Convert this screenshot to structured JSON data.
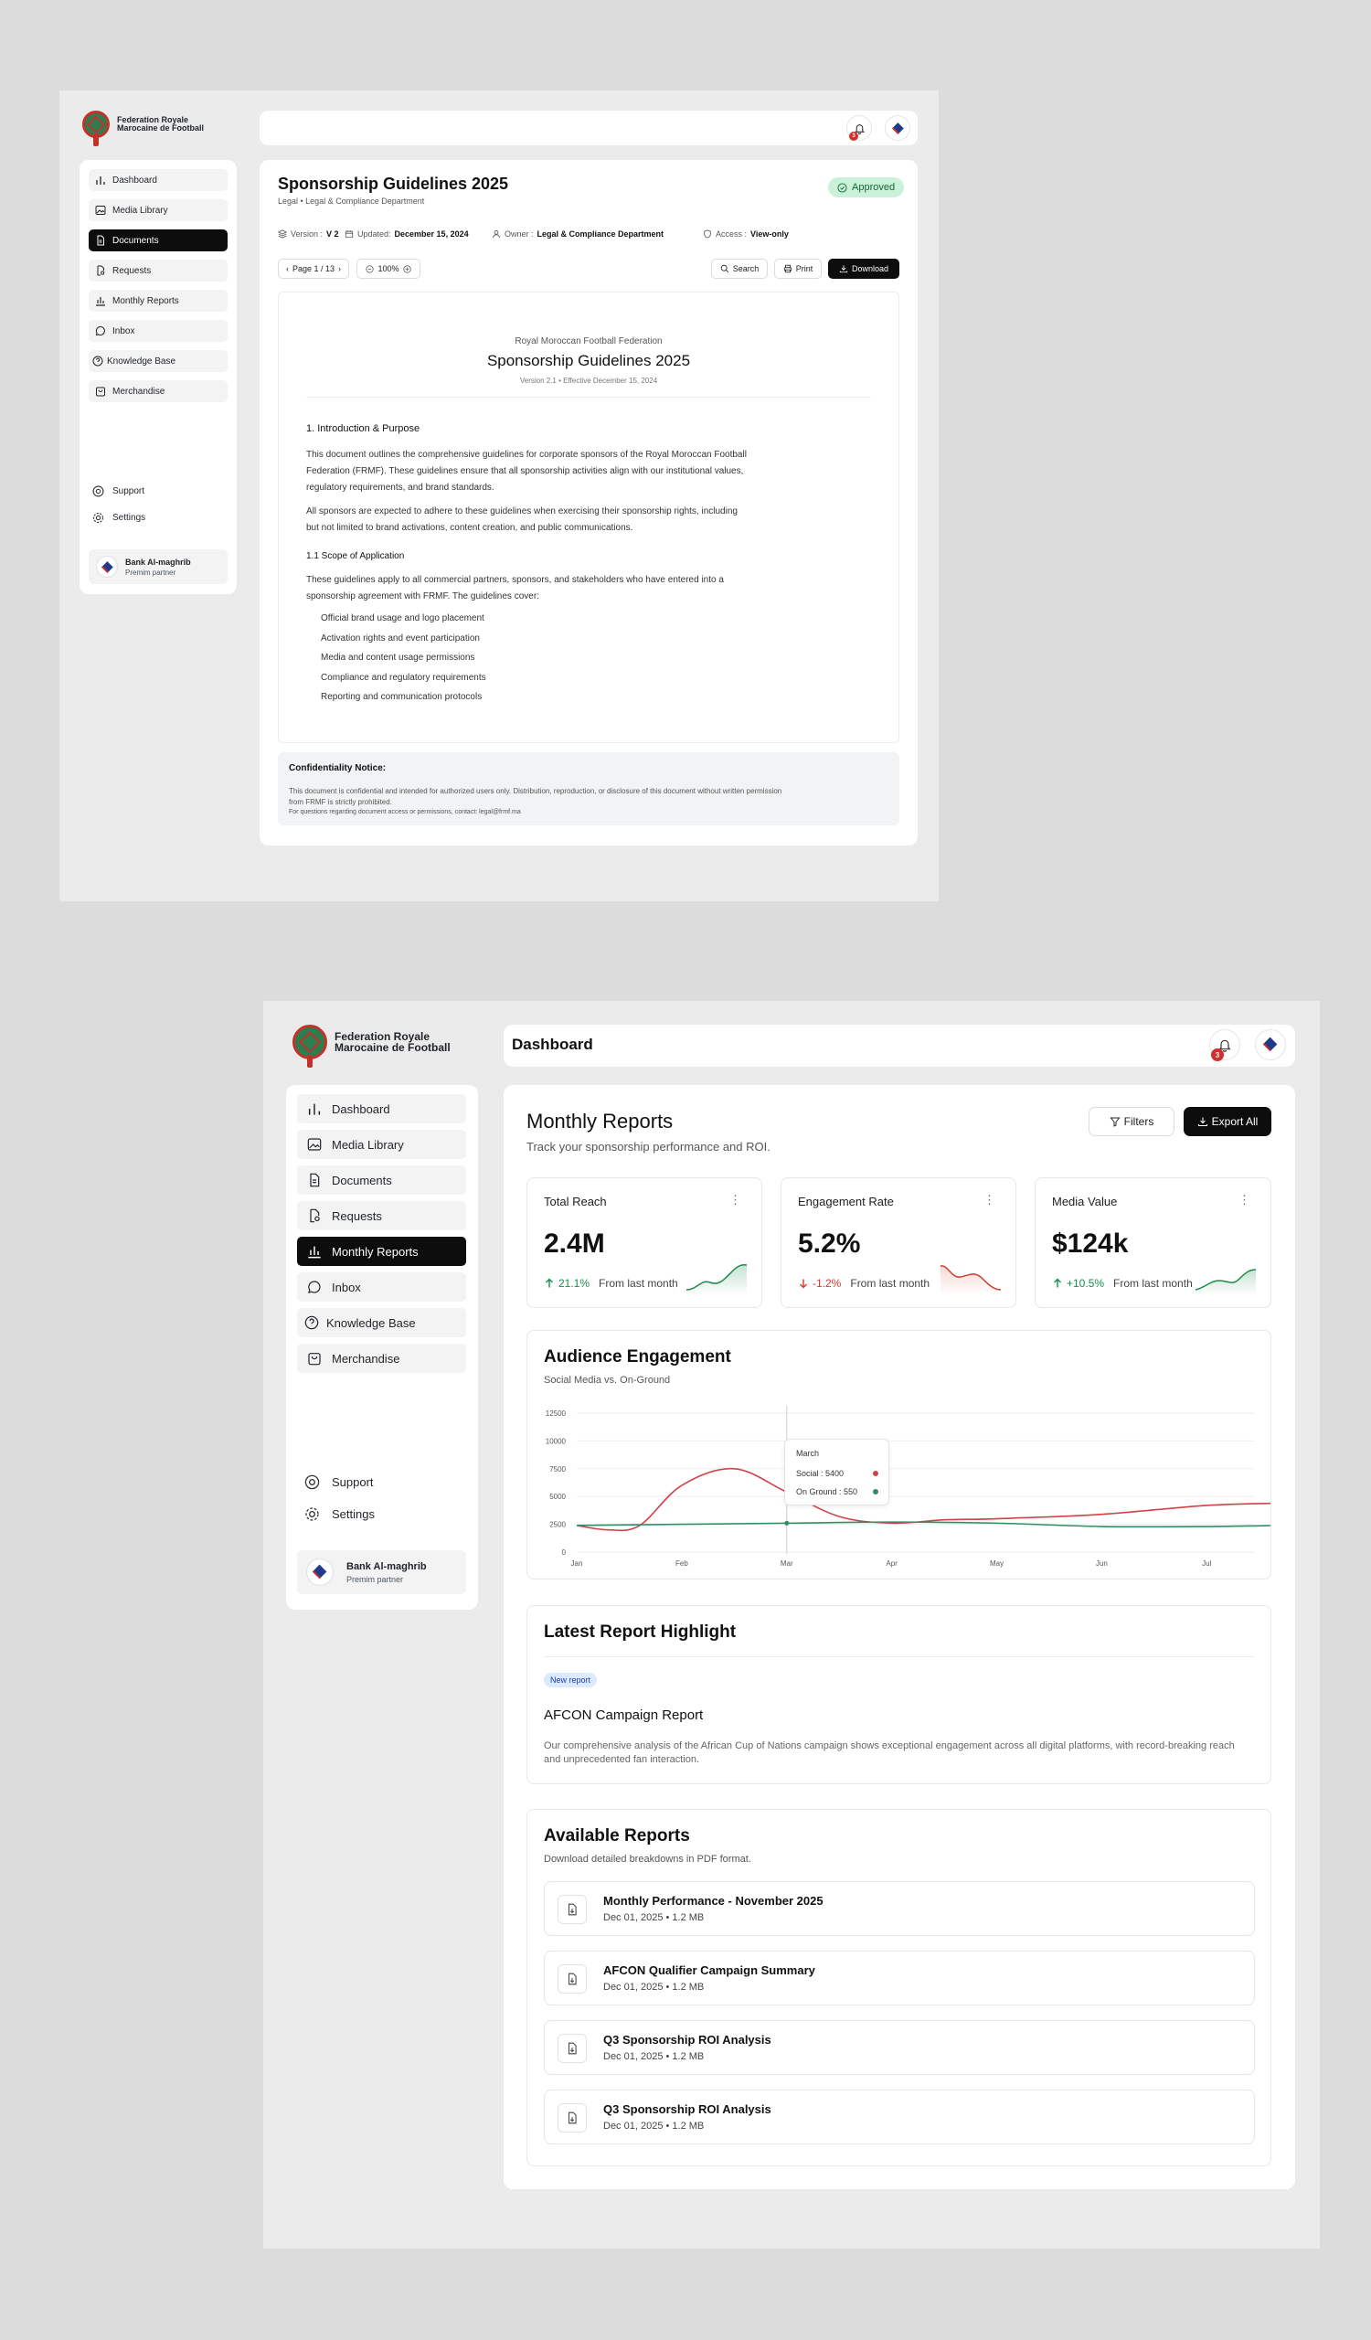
{
  "brand": {
    "line1": "Federation Royale",
    "line2": "Marocaine de Football"
  },
  "sidebar": {
    "items": [
      {
        "label": "Dashboard",
        "icon": "bar-chart-icon"
      },
      {
        "label": "Media Library",
        "icon": "image-icon"
      },
      {
        "label": "Documents",
        "icon": "document-icon"
      },
      {
        "label": "Requests",
        "icon": "file-search-icon"
      },
      {
        "label": "Monthly Reports",
        "icon": "chart-icon"
      },
      {
        "label": "Inbox",
        "icon": "chat-icon"
      },
      {
        "label": "Knowledge Base",
        "icon": "question-icon"
      },
      {
        "label": "Merchandise",
        "icon": "bag-icon"
      }
    ],
    "support_label": "Support",
    "settings_label": "Settings",
    "partner": {
      "name": "Bank Al-maghrib",
      "tier": "Premim partner"
    }
  },
  "doc_view": {
    "title": "Sponsorship Guidelines 2025",
    "subtitle": "Legal • Legal & Compliance Department",
    "status": "Approved",
    "meta": {
      "version_label": "Version :",
      "version": "V 2",
      "updated_label": "Updated:",
      "updated": "December 15, 2024",
      "owner_label": "Owner :",
      "owner": "Legal & Compliance Department",
      "access_label": "Access :",
      "access": "View-only"
    },
    "toolbar": {
      "page": "Page 1 / 13",
      "zoom": "100%",
      "search": "Search",
      "print": "Print",
      "download": "Download"
    },
    "page": {
      "org": "Royal Moroccan Football Federation",
      "heading": "Sponsorship Guidelines 2025",
      "version_line": "Version 2.1 • Effective December 15, 2024",
      "section1_title": "1. Introduction & Purpose",
      "para1": "This document outlines the comprehensive guidelines for corporate sponsors of the Royal Moroccan Football Federation (FRMF). These guidelines ensure that all sponsorship activities align with our institutional values, regulatory requirements, and brand standards.",
      "para2": "All sponsors are expected to adhere to these guidelines when exercising their sponsorship rights, including but not limited to brand activations, content creation, and public communications.",
      "section2_title": "1.1 Scope of Application",
      "para3": "These guidelines apply to all commercial partners, sponsors, and stakeholders who have entered into a sponsorship agreement with FRMF. The guidelines cover:",
      "list": [
        "Official brand usage and logo placement",
        "Activation rights and event participation",
        "Media and content usage permissions",
        "Compliance and regulatory requirements",
        "Reporting and communication protocols"
      ]
    },
    "notice": {
      "title": "Confidentiality Notice:",
      "line1": "This document is confidential and intended for authorized users only. Distribution, reproduction, or disclosure of this document without written permission",
      "line2": "from FRMF is strictly prohibited.",
      "line3": "For questions regarding document access or permissions, contact: legal@frmf.ma"
    }
  },
  "dashboard": {
    "topbar_title": "Dashboard",
    "notif_count": "3",
    "header": {
      "title": "Monthly Reports",
      "subtitle": "Track your sponsorship performance and ROI.",
      "filters": "Filters",
      "export": "Export All"
    },
    "stats": [
      {
        "label": "Total Reach",
        "value": "2.4M",
        "change": "21.1%",
        "direction": "up",
        "note": "From last month",
        "color": "#1a8a4a"
      },
      {
        "label": "Engagement Rate",
        "value": "5.2%",
        "change": "-1.2%",
        "direction": "down",
        "note": "From last month",
        "color": "#d43a2f"
      },
      {
        "label": "Media Value",
        "value": "$124k",
        "change": "+10.5%",
        "direction": "up",
        "note": "From last month",
        "color": "#1a8a4a"
      }
    ],
    "engagement": {
      "title": "Audience Engagement",
      "subtitle": "Social Media vs. On-Ground",
      "tooltip": {
        "month": "March",
        "social": "Social : 5400",
        "onground": "On Ground : 550"
      }
    },
    "highlight": {
      "section_title": "Latest Report Highlight",
      "tag": "New report",
      "title": "AFCON Campaign Report",
      "description": "Our comprehensive analysis of the African Cup of Nations campaign shows exceptional engagement across all digital platforms, with record-breaking reach and unprecedented fan interaction."
    },
    "available": {
      "title": "Available Reports",
      "subtitle": "Download detailed breakdowns in PDF format.",
      "items": [
        {
          "title": "Monthly Performance - November 2025",
          "meta": "Dec 01, 2025 • 1.2 MB"
        },
        {
          "title": "AFCON Qualifier Campaign Summary",
          "meta": "Dec 01, 2025 • 1.2 MB"
        },
        {
          "title": "Q3 Sponsorship ROI Analysis",
          "meta": "Dec 01, 2025 • 1.2 MB"
        },
        {
          "title": "Q3 Sponsorship ROI Analysis",
          "meta": "Dec 01, 2025 • 1.2 MB"
        }
      ]
    }
  },
  "chart_data": {
    "type": "line",
    "title": "Audience Engagement",
    "subtitle": "Social Media vs. On-Ground",
    "categories": [
      "Jan",
      "Feb",
      "Mar",
      "Apr",
      "May",
      "Jun",
      "Jul"
    ],
    "ylim": [
      0,
      12500
    ],
    "yticks": [
      0,
      2500,
      5000,
      7500,
      10000,
      12500
    ],
    "grid": true,
    "series": [
      {
        "name": "Social",
        "color": "#d1414a",
        "x": [
          0,
          0.3,
          0.6,
          1.0,
          1.5,
          2.0,
          2.5,
          3.0,
          3.5,
          4.0,
          5.0,
          6.0,
          6.7
        ],
        "values": [
          2400,
          2000,
          2400,
          6000,
          7500,
          5400,
          3200,
          2600,
          2900,
          3000,
          3400,
          4200,
          4400
        ]
      },
      {
        "name": "On Ground",
        "color": "#2f8f63",
        "x": [
          0,
          1,
          2,
          3,
          4,
          5,
          6,
          6.7
        ],
        "values": [
          2400,
          2500,
          2600,
          2700,
          2600,
          2300,
          2300,
          2400
        ]
      }
    ],
    "tooltip_x": "Mar"
  }
}
